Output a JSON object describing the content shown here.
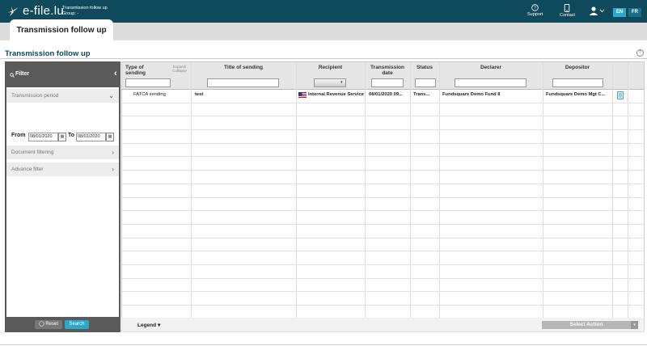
{
  "app": {
    "logo": "e-file.lu",
    "subtitle_line1": "Transmission follow up",
    "subtitle_line2": "Group: -"
  },
  "topbar": {
    "support_label": "Support",
    "contact_label": "Contact",
    "lang_en": "EN",
    "lang_fr": "FR",
    "icons": [
      "help-circle-icon",
      "phone-icon",
      "user-icon"
    ]
  },
  "tab": {
    "label": "Transmission follow up"
  },
  "page": {
    "title": "Transmission follow up",
    "help": "?"
  },
  "filter": {
    "title": "Filter",
    "collapse_chevron": "‹",
    "transmission_period_label": "Transmission period",
    "from_label": "From",
    "to_label": "To",
    "from_value": "08/01/2020",
    "to_value": "08/01/2020",
    "document_filtering_label": "Document filtering",
    "advance_filter_label": "Advance filter",
    "reset_label": "Reset",
    "search_label": "Search"
  },
  "grid": {
    "columns": {
      "type": "Type of sending",
      "expand": "Expand/ Collapse",
      "title": "Title of sending",
      "recipient": "Recipient",
      "date": "Transmission date",
      "status": "Status",
      "declarer": "Declarer",
      "depositor": "Depositor"
    },
    "rows": [
      {
        "type": "FATCA sending",
        "title": "test",
        "recipient": "Internal Revenue Service",
        "date": "08/01/2020 09...",
        "status": "Trans...",
        "declarer": "Fundsquare Demo Fund 8",
        "depositor": "Fundsquare Demo Mgt C..."
      }
    ]
  },
  "footer": {
    "legend_label": "Legend",
    "select_action_label": "Select Action"
  },
  "colors": {
    "topbar": "#0f4a5c",
    "accent": "#2aa9c9",
    "filter_panel": "#5a5a5a"
  }
}
